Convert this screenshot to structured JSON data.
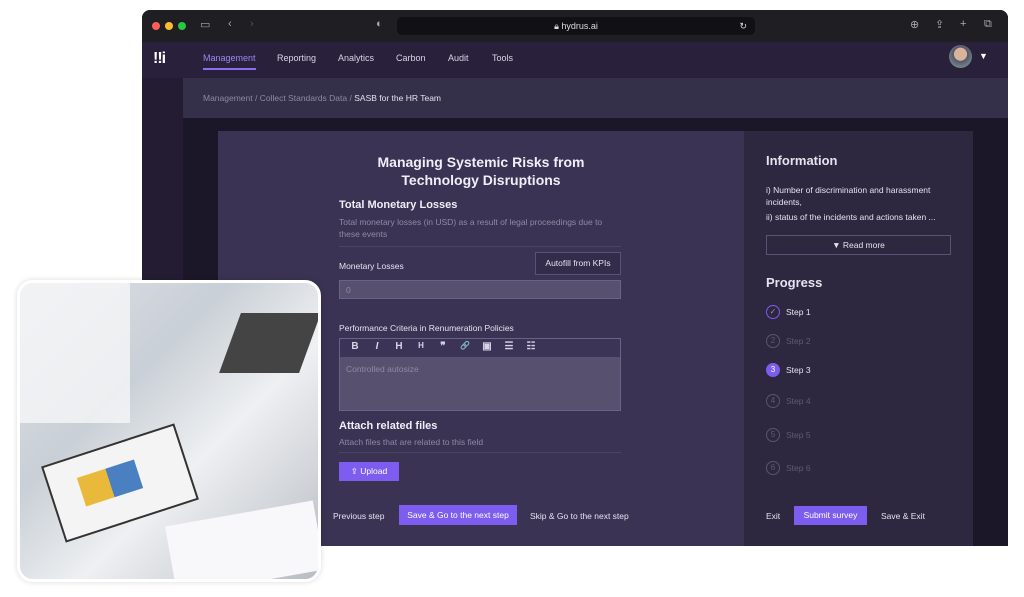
{
  "browser": {
    "url": "hydrus.ai"
  },
  "nav": {
    "logo": "!!i",
    "items": [
      {
        "label": "Management",
        "active": true
      },
      {
        "label": "Reporting"
      },
      {
        "label": "Analytics"
      },
      {
        "label": "Carbon"
      },
      {
        "label": "Audit"
      },
      {
        "label": "Tools"
      }
    ]
  },
  "breadcrumb": [
    "Management",
    "Collect Standards Data",
    "SASB for the HR Team"
  ],
  "form": {
    "title_line1": "Managing Systemic Risks from",
    "title_line2": "Technology Disruptions",
    "section1": {
      "title": "Total Monetary Losses",
      "description": "Total monetary losses (in USD) as a result of legal proceedings due to these events"
    },
    "monetary_label": "Monetary Losses",
    "autofill": "Autofill from KPIs",
    "monetary_placeholder": "0",
    "criteria_label": "Performance Criteria in Renumeration Policies",
    "toolbar": [
      "B",
      "I",
      "H",
      "H",
      "❞",
      "🔗",
      "▣",
      "☰",
      "☷"
    ],
    "editor_placeholder": "Controlled autosize",
    "attach": {
      "title": "Attach related files",
      "description": "Attach files that are related to this field",
      "upload": "Upload"
    },
    "prev": "Previous step",
    "save_next": "Save & Go to the next step",
    "skip_next": "Skip & Go to the next step"
  },
  "info": {
    "title": "Information",
    "line1": "i) Number of discrimination and harassment incidents,",
    "line2": "ii) status of the incidents and actions taken ...",
    "read_more": "Read more"
  },
  "progress": {
    "title": "Progress",
    "steps": [
      {
        "n": "✓",
        "label": "Step 1",
        "state": "done"
      },
      {
        "n": "2",
        "label": "Step 2",
        "state": "todo"
      },
      {
        "n": "3",
        "label": "Step 3",
        "state": "current"
      },
      {
        "n": "4",
        "label": "Step 4",
        "state": "todo"
      },
      {
        "n": "5",
        "label": "Step 5",
        "state": "todo"
      },
      {
        "n": "6",
        "label": "Step 6",
        "state": "todo"
      }
    ]
  },
  "footer": {
    "exit": "Exit",
    "submit": "Submit survey",
    "save_exit": "Save & Exit"
  },
  "colors": {
    "accent": "#7c5df0",
    "background": "#1c1728",
    "card": "#3a3353"
  }
}
